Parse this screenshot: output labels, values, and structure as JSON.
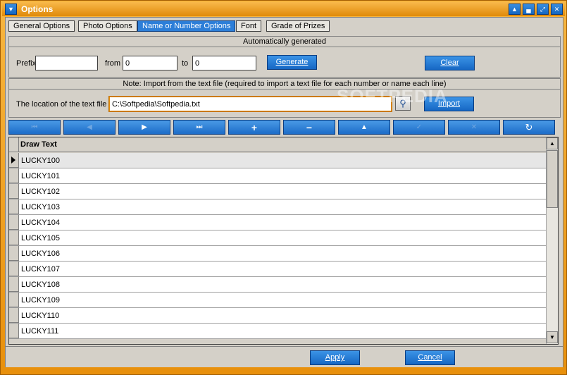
{
  "window": {
    "title": "Options",
    "buttons": [
      "minimize-icon",
      "restore-icon",
      "maximize-icon",
      "close-icon"
    ]
  },
  "tabs": [
    {
      "label": "General Options",
      "active": false
    },
    {
      "label": "Photo Options",
      "active": false
    },
    {
      "label": "Name or Number Options",
      "active": true
    },
    {
      "label": "Font",
      "active": false
    },
    {
      "label": "Grade of Prizes",
      "active": false
    }
  ],
  "auto": {
    "header": "Automatically generated",
    "prefix_label": "Prefix",
    "prefix_value": "",
    "from_label": "from",
    "from_value": "0",
    "to_label": "to",
    "to_value": "0",
    "generate_label": "Generate",
    "clear_label": "Clear"
  },
  "import": {
    "header": "Note: Import from the text file (required to import a text file for each number or name each line)",
    "location_label": "The location of the text file",
    "path_value": "C:\\Softpedia\\Softpedia.txt",
    "import_label": "Import"
  },
  "navigator": [
    {
      "name": "nav-first-button",
      "glyph": "⏮",
      "enabled": false
    },
    {
      "name": "nav-prior-button",
      "glyph": "◀",
      "enabled": false
    },
    {
      "name": "nav-next-button",
      "glyph": "▶",
      "enabled": true
    },
    {
      "name": "nav-last-button",
      "glyph": "⏭",
      "enabled": true
    },
    {
      "name": "nav-insert-button",
      "glyph": "+",
      "enabled": true
    },
    {
      "name": "nav-delete-button",
      "glyph": "−",
      "enabled": true
    },
    {
      "name": "nav-edit-button",
      "glyph": "▲",
      "enabled": true
    },
    {
      "name": "nav-post-button",
      "glyph": "✓",
      "enabled": false
    },
    {
      "name": "nav-cancel-button",
      "glyph": "✕",
      "enabled": false
    },
    {
      "name": "nav-refresh-button",
      "glyph": "↻",
      "enabled": true
    }
  ],
  "grid": {
    "column": "Draw Text",
    "rows": [
      "LUCKY100",
      "LUCKY101",
      "LUCKY102",
      "LUCKY103",
      "LUCKY104",
      "LUCKY105",
      "LUCKY106",
      "LUCKY107",
      "LUCKY108",
      "LUCKY109",
      "LUCKY110",
      "LUCKY111"
    ]
  },
  "footer": {
    "apply_label": "Apply",
    "cancel_label": "Cancel"
  },
  "watermark": "SOFTPEDIA",
  "colors": {
    "frame": "#e8900c",
    "accent_button": "#1667c4",
    "active_tab": "#2c7ed8"
  }
}
